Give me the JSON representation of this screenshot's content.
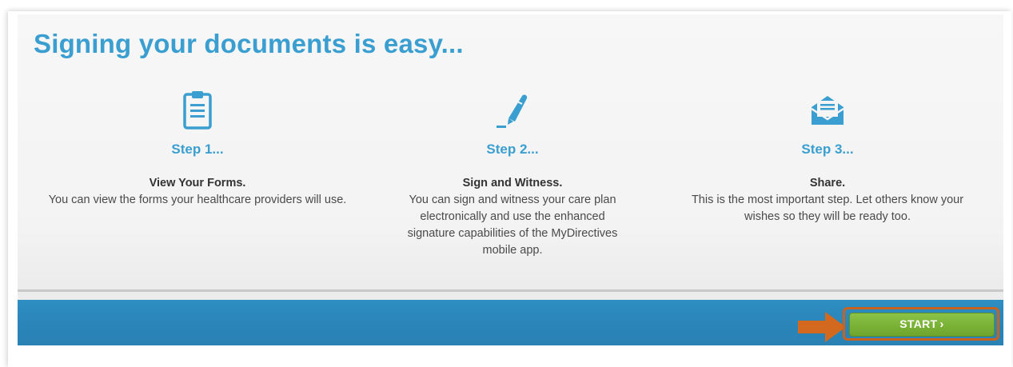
{
  "title": "Signing your documents is easy...",
  "steps": [
    {
      "icon": "clipboard-icon",
      "heading": "Step 1...",
      "name": "View Your Forms.",
      "text": "You can view the forms your healthcare providers will use."
    },
    {
      "icon": "pen-signature-icon",
      "heading": "Step 2...",
      "name": "Sign and Witness.",
      "text": "You can sign and witness your care plan electronically and use the enhanced signature capabilities of the MyDirectives mobile app."
    },
    {
      "icon": "envelope-icon",
      "heading": "Step 3...",
      "name": "Share.",
      "text": "This is the most important step. Let others know your wishes so they will be ready too."
    }
  ],
  "footer": {
    "start_label": "START",
    "start_chevron": "›"
  },
  "colors": {
    "accent_blue": "#3a9fd0",
    "bar_blue": "#2a84b8",
    "start_green": "#7ab236",
    "highlight_orange": "#c9621c"
  }
}
